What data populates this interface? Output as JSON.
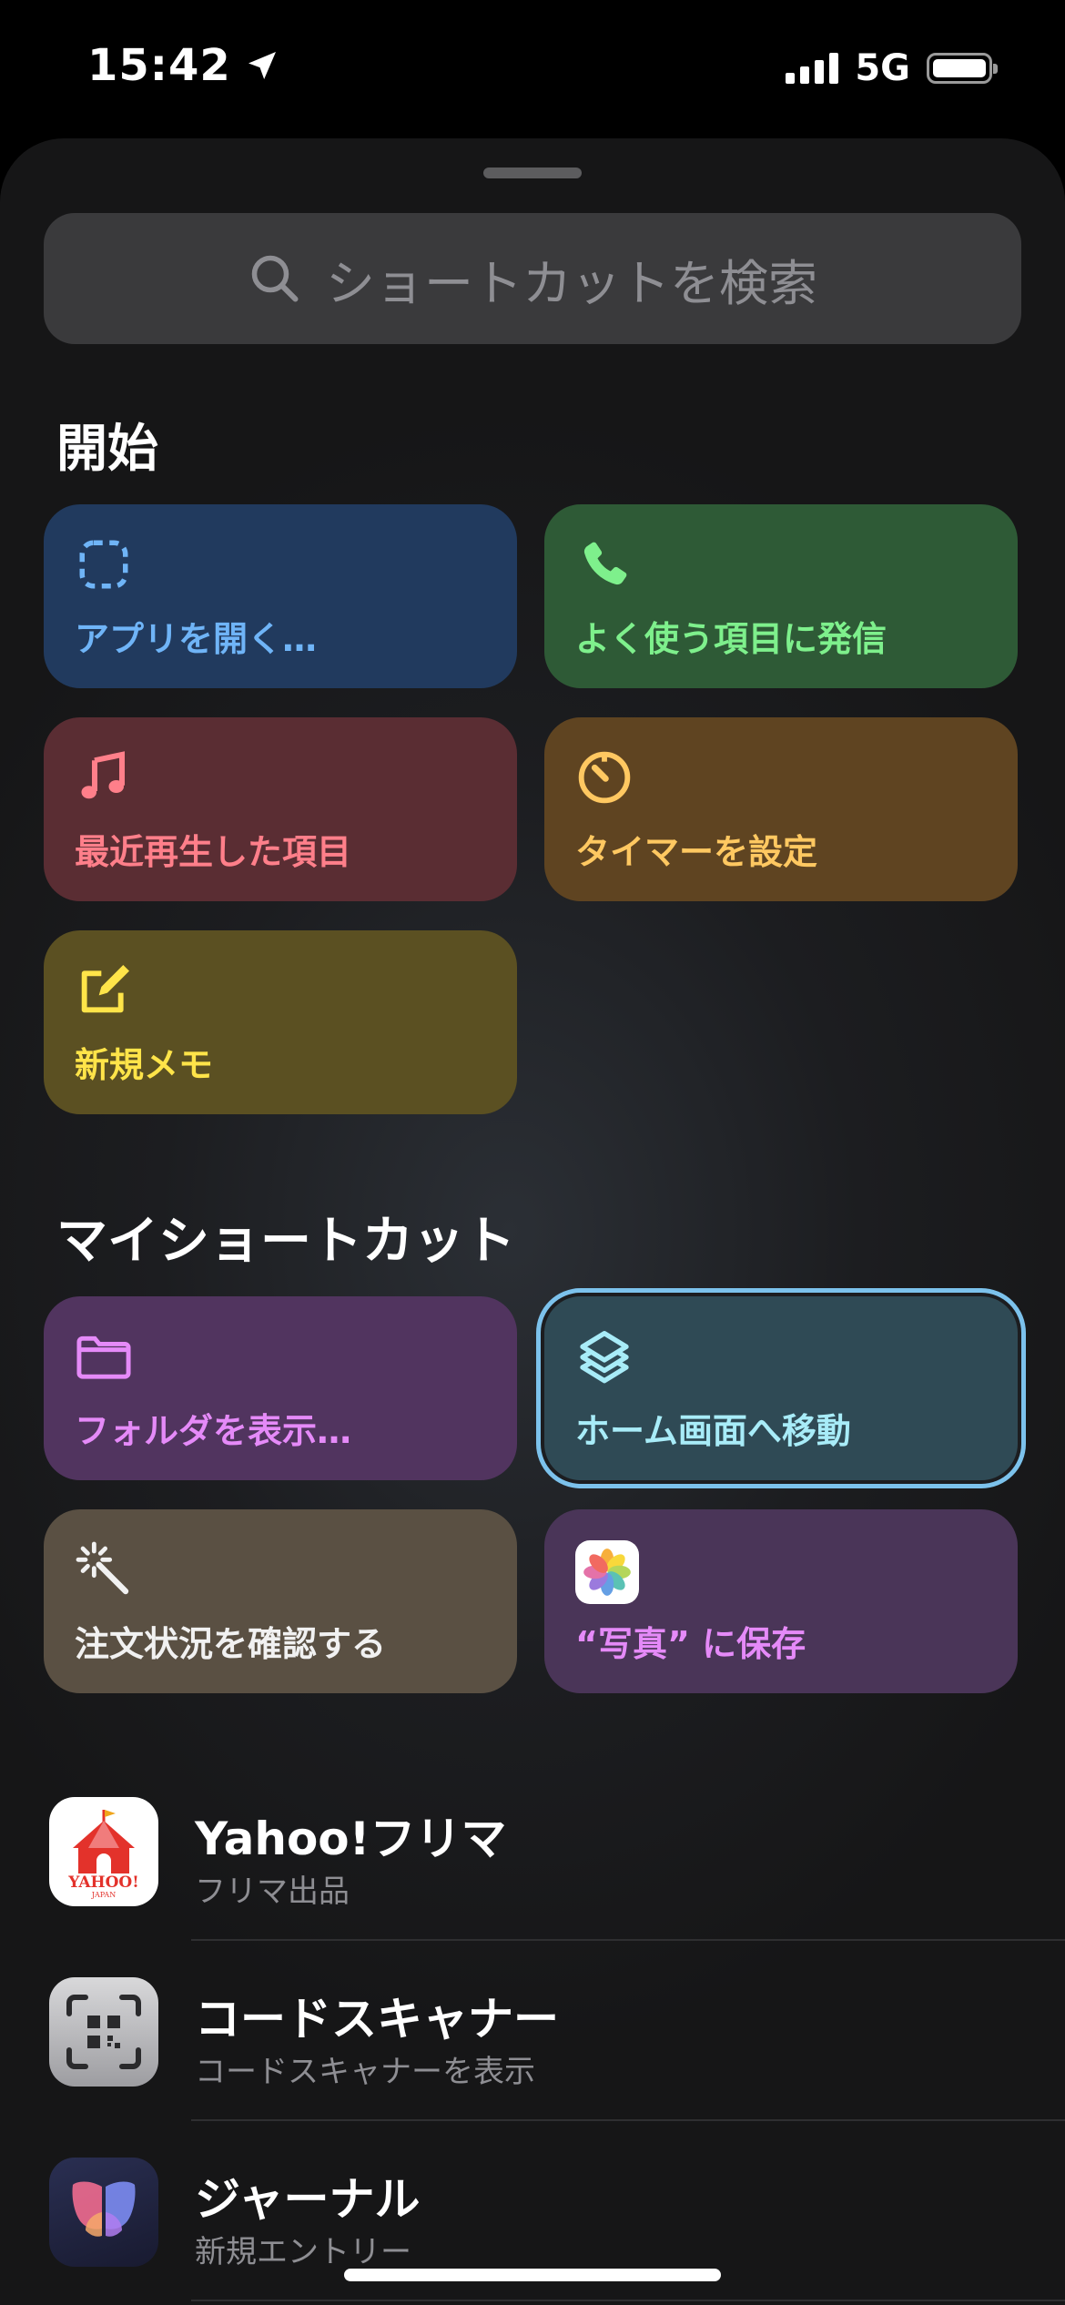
{
  "status_bar": {
    "time": "15:42",
    "network": "5G",
    "battery_level": 1.0
  },
  "search": {
    "placeholder": "ショートカットを検索"
  },
  "sections": {
    "start_title": "開始",
    "my_title": "マイショートカット"
  },
  "start_tiles": [
    {
      "label": "アプリを開く…",
      "icon": "dashed-square-icon",
      "bg": "#213a5e",
      "fg": "#6fb4f7"
    },
    {
      "label": "よく使う項目に発信",
      "icon": "phone-icon",
      "bg": "#2e5a36",
      "fg": "#7ef08c"
    },
    {
      "label": "最近再生した項目",
      "icon": "music-note-icon",
      "bg": "#5a2d33",
      "fg": "#ff7f8a"
    },
    {
      "label": "タイマーを設定",
      "icon": "timer-icon",
      "bg": "#5f4421",
      "fg": "#ffc861"
    },
    {
      "label": "新規メモ",
      "icon": "compose-icon",
      "bg": "#5b5022",
      "fg": "#ffe449"
    }
  ],
  "my_tiles": [
    {
      "label": "フォルダを表示…",
      "icon": "folder-icon",
      "bg": "#51345f",
      "fg": "#e58af8"
    },
    {
      "label": "ホーム画面へ移動",
      "icon": "layers-icon",
      "bg": "#2f4a55",
      "fg": "#a8ecf8",
      "selected": true
    },
    {
      "label": "注文状況を確認する",
      "icon": "magic-wand-icon",
      "bg": "#5a5043",
      "fg": "#f1f1f1"
    },
    {
      "label": "“写真” に保存",
      "icon": "photos-app-icon",
      "bg": "#4a3558",
      "fg": "#e58af8"
    }
  ],
  "app_list": [
    {
      "title": "Yahoo!フリマ",
      "subtitle": "フリマ出品",
      "icon": "yahoo-flea-market-app-icon",
      "logo_text": "YAHOO!",
      "logo_sub": "JAPAN"
    },
    {
      "title": "コードスキャナー",
      "subtitle": "コードスキャナーを表示",
      "icon": "code-scanner-app-icon"
    },
    {
      "title": "ジャーナル",
      "subtitle": "新規エントリー",
      "icon": "journal-app-icon"
    }
  ]
}
